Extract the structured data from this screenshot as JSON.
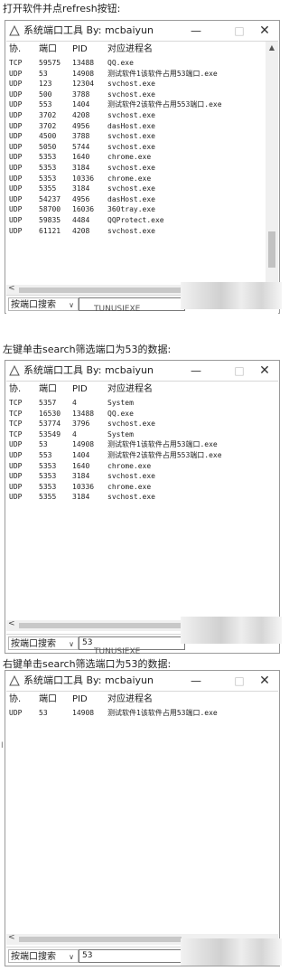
{
  "window": {
    "title": "系统端口工具 By: mcbaiyun",
    "minimize_label": "—",
    "maximize_label": "□",
    "close_label": "✕",
    "search_type_label": "按端口搜索",
    "columns": [
      "协.",
      "端口",
      "PID",
      "对应进程名"
    ]
  },
  "panels": [
    {
      "caption": "打开软件并点refresh按钮:",
      "search_value": "",
      "rows": [
        [
          "TCP",
          "59575",
          "13488",
          "QQ.exe"
        ],
        [
          "UDP",
          "53",
          "14908",
          "测试软件1该软件占用53端口.exe"
        ],
        [
          "UDP",
          "123",
          "12304",
          "svchost.exe"
        ],
        [
          "UDP",
          "500",
          "3788",
          "svchost.exe"
        ],
        [
          "UDP",
          "553",
          "1404",
          "测试软件2该软件占用553端口.exe"
        ],
        [
          "UDP",
          "3702",
          "4208",
          "svchost.exe"
        ],
        [
          "UDP",
          "3702",
          "4956",
          "dasHost.exe"
        ],
        [
          "UDP",
          "4500",
          "3788",
          "svchost.exe"
        ],
        [
          "UDP",
          "5050",
          "5744",
          "svchost.exe"
        ],
        [
          "UDP",
          "5353",
          "1640",
          "chrome.exe"
        ],
        [
          "UDP",
          "5353",
          "3184",
          "svchost.exe"
        ],
        [
          "UDP",
          "5353",
          "10336",
          "chrome.exe"
        ],
        [
          "UDP",
          "5355",
          "3184",
          "svchost.exe"
        ],
        [
          "UDP",
          "54237",
          "4956",
          "dasHost.exe"
        ],
        [
          "UDP",
          "58700",
          "16036",
          "360tray.exe"
        ],
        [
          "UDP",
          "59835",
          "4484",
          "QQProtect.exe"
        ],
        [
          "UDP",
          "61121",
          "4208",
          "svchost.exe"
        ]
      ]
    },
    {
      "caption": "左键单击search筛选端口为53的数据:",
      "search_value": "53",
      "rows": [
        [
          "TCP",
          "5357",
          "4",
          "System"
        ],
        [
          "TCP",
          "16530",
          "13488",
          "QQ.exe"
        ],
        [
          "TCP",
          "53774",
          "3796",
          "svchost.exe"
        ],
        [
          "TCP",
          "53549",
          "4",
          "System"
        ],
        [
          "UDP",
          "53",
          "14908",
          "测试软件1该软件占用53端口.exe"
        ],
        [
          "UDP",
          "553",
          "1404",
          "测试软件2该软件占用553端口.exe"
        ],
        [
          "UDP",
          "5353",
          "1640",
          "chrome.exe"
        ],
        [
          "UDP",
          "5353",
          "3184",
          "svchost.exe"
        ],
        [
          "UDP",
          "5353",
          "10336",
          "chrome.exe"
        ],
        [
          "UDP",
          "5355",
          "3184",
          "svchost.exe"
        ]
      ]
    },
    {
      "caption": "右键单击search筛选端口为53的数据:",
      "search_value": "53",
      "rows": [
        [
          "UDP",
          "53",
          "14908",
          "测试软件1该软件占用53端口.exe"
        ]
      ]
    }
  ],
  "behind_text": "TUNUSIEXE"
}
